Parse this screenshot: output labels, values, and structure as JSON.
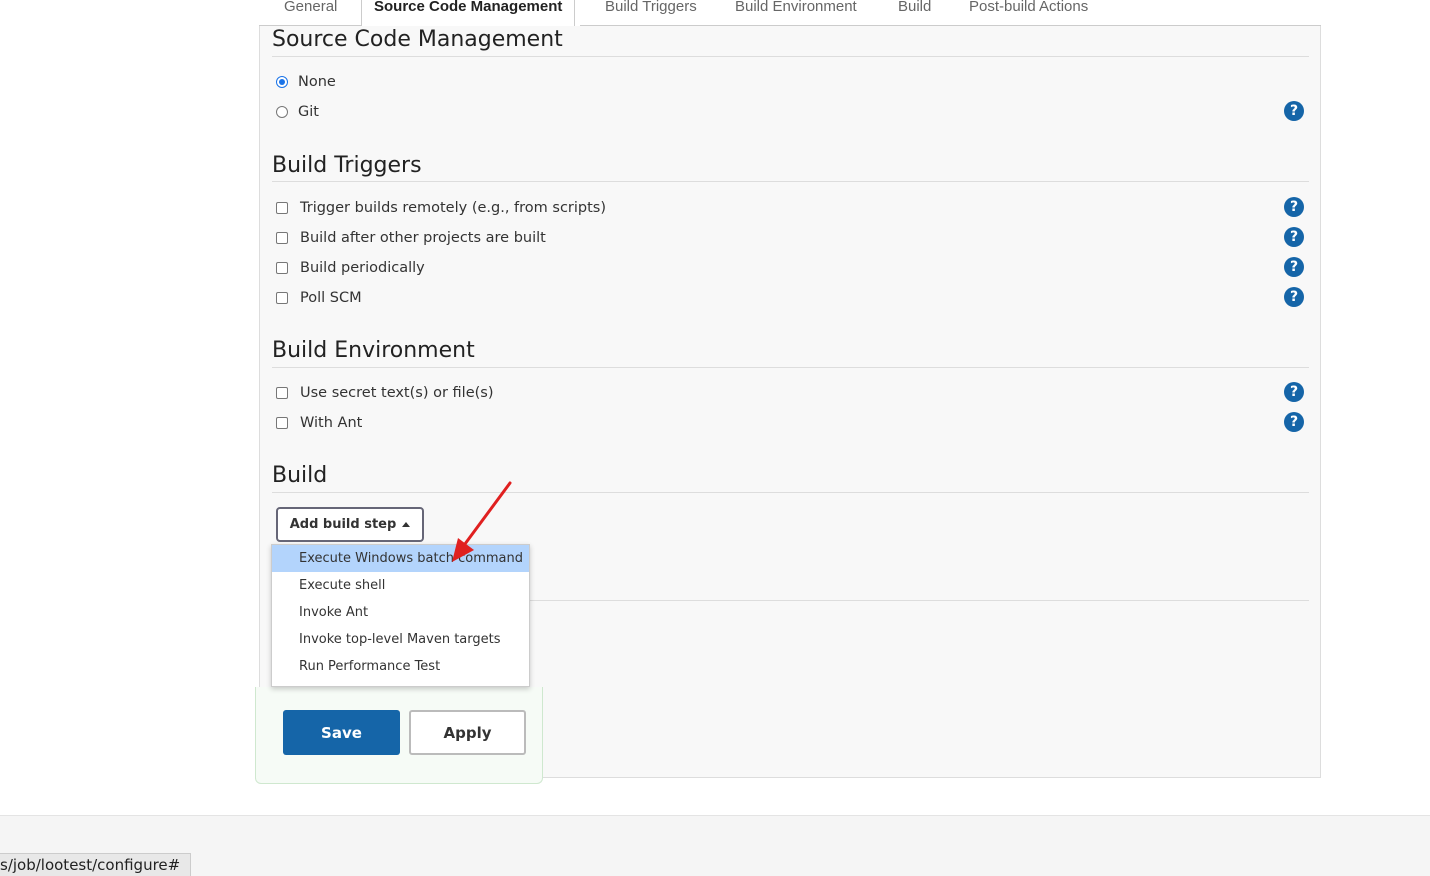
{
  "tabs": [
    "General",
    "Source Code Management",
    "Build Triggers",
    "Build Environment",
    "Build",
    "Post-build Actions"
  ],
  "active_tab": "Source Code Management",
  "scm": {
    "title": "Source Code Management",
    "options": [
      {
        "label": "None",
        "selected": true
      },
      {
        "label": "Git",
        "selected": false
      }
    ]
  },
  "triggers": {
    "title": "Build Triggers",
    "options": [
      "Trigger builds remotely (e.g., from scripts)",
      "Build after other projects are built",
      "Build periodically",
      "Poll SCM"
    ]
  },
  "environment": {
    "title": "Build Environment",
    "options": [
      "Use secret text(s) or file(s)",
      "With Ant"
    ]
  },
  "build": {
    "title": "Build",
    "add_step_label": "Add build step",
    "menu": [
      "Execute Windows batch command",
      "Execute shell",
      "Invoke Ant",
      "Invoke top-level Maven targets",
      "Run Performance Test"
    ],
    "highlighted_item": "Execute Windows batch command"
  },
  "actions": {
    "save": "Save",
    "apply": "Apply"
  },
  "help_glyph": "?",
  "status_url": "s/job/lootest/configure#",
  "colors": {
    "primary": "#1565a8",
    "highlight": "#b3d4fc",
    "annotation_arrow": "#e02020"
  }
}
